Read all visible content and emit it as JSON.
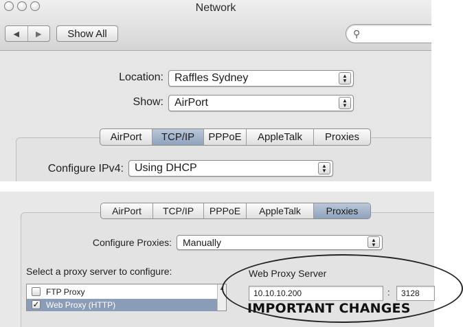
{
  "window": {
    "title": "Network",
    "show_all_label": "Show All",
    "search_placeholder": ""
  },
  "location": {
    "label": "Location:",
    "value": "Raffles Sydney"
  },
  "show": {
    "label": "Show:",
    "value": "AirPort"
  },
  "tabs": [
    "AirPort",
    "TCP/IP",
    "PPPoE",
    "AppleTalk",
    "Proxies"
  ],
  "panel1_selected_tab": "TCP/IP",
  "configure_ipv4": {
    "label": "Configure IPv4:",
    "value": "Using DHCP"
  },
  "panel2_selected_tab": "Proxies",
  "configure_proxies": {
    "label": "Configure Proxies:",
    "value": "Manually"
  },
  "proxy_list": {
    "label": "Select a proxy server to configure:",
    "items": [
      {
        "label": "FTP Proxy",
        "checked": false,
        "selected": false
      },
      {
        "label": "Web Proxy (HTTP)",
        "checked": true,
        "selected": true
      }
    ]
  },
  "web_proxy": {
    "label": "Web Proxy Server",
    "server": "10.10.10.200",
    "colon": ":",
    "port": "3128"
  },
  "annotation": {
    "text": "IMPORTANT CHANGES"
  },
  "colors": {
    "selected_tab": "#8fa3bd",
    "selected_row": "#8a9db8",
    "window_bg": "#e8e8e8"
  },
  "icons": [
    "back-arrow-icon",
    "forward-arrow-icon",
    "search-icon",
    "popup-arrows-icon",
    "checkbox-icon",
    "scroll-up-icon"
  ]
}
